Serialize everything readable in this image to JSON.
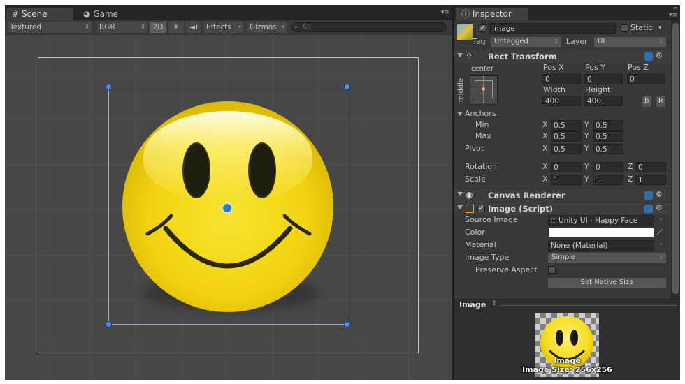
{
  "scene": {
    "tabs": [
      {
        "label": "Scene",
        "icon": "grid-icon"
      },
      {
        "label": "Game",
        "icon": "pacman-icon"
      }
    ],
    "toolbar": {
      "shading": "Textured",
      "render_mode": "RGB",
      "mode_2d": "2D",
      "effects": "Effects",
      "gizmos": "Gizmos",
      "search_placeholder": "All"
    }
  },
  "inspector": {
    "tab_label": "Inspector",
    "object": {
      "name": "Image",
      "static_label": "Static",
      "tag_label": "Tag",
      "tag_value": "Untagged",
      "layer_label": "Layer",
      "layer_value": "UI"
    },
    "rect_transform": {
      "title": "Rect Transform",
      "anchor_h": "center",
      "anchor_v": "middle",
      "labels": {
        "pos_x": "Pos X",
        "pos_y": "Pos Y",
        "pos_z": "Pos Z",
        "width": "Width",
        "height": "Height"
      },
      "values": {
        "pos_x": "0",
        "pos_y": "0",
        "pos_z": "0",
        "width": "400",
        "height": "400"
      },
      "btn_b": "b",
      "btn_r": "R",
      "anchors_label": "Anchors",
      "min_label": "Min",
      "max_label": "Max",
      "pivot_label": "Pivot",
      "rotation_label": "Rotation",
      "scale_label": "Scale",
      "axis": {
        "x": "X",
        "y": "Y",
        "z": "Z"
      },
      "anchor_min": {
        "x": "0.5",
        "y": "0.5"
      },
      "anchor_max": {
        "x": "0.5",
        "y": "0.5"
      },
      "pivot": {
        "x": "0.5",
        "y": "0.5"
      },
      "rotation": {
        "x": "0",
        "y": "0",
        "z": "0"
      },
      "scale": {
        "x": "1",
        "y": "1",
        "z": "1"
      }
    },
    "canvas_renderer": {
      "title": "Canvas Renderer"
    },
    "image_script": {
      "title": "Image (Script)",
      "source_image_label": "Source Image",
      "source_image_value": "Unity UI - Happy Face",
      "color_label": "Color",
      "color_value": "#ffffff",
      "material_label": "Material",
      "material_value": "None (Material)",
      "image_type_label": "Image Type",
      "image_type_value": "Simple",
      "preserve_aspect_label": "Preserve Aspect",
      "set_native_size": "Set Native Size"
    },
    "preview": {
      "header": "Image",
      "name": "Image",
      "size_text": "Image Size: 256x256"
    }
  },
  "colors": {
    "accent": "#4a8fe8",
    "face": "#f2d312"
  }
}
